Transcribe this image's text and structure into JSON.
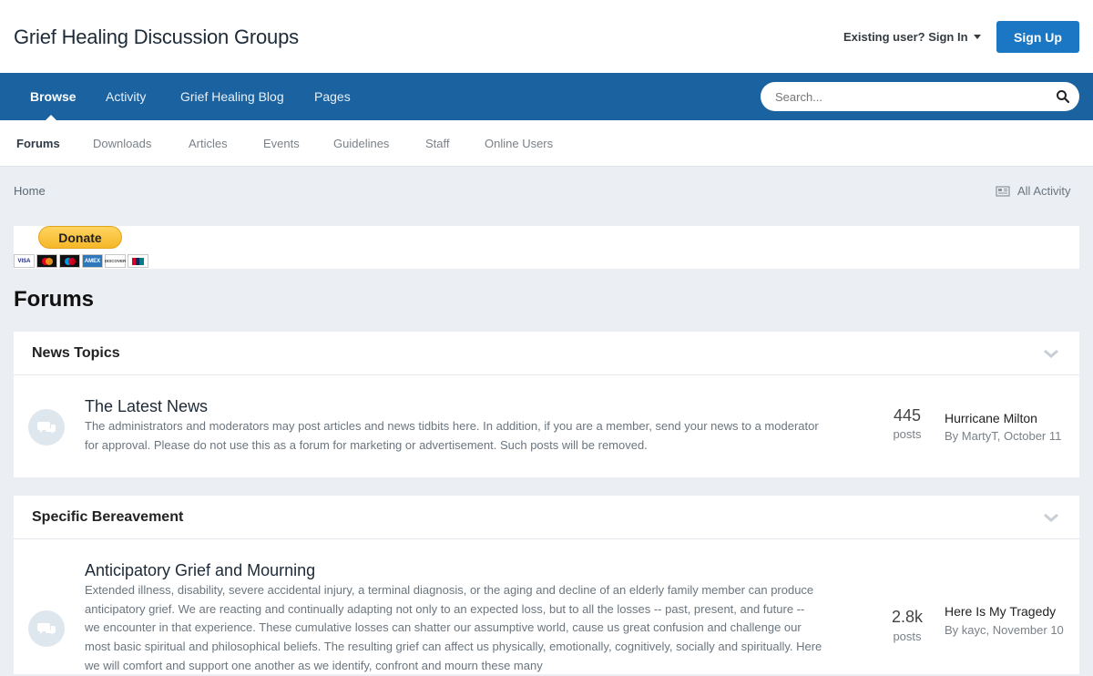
{
  "header": {
    "site_title": "Grief Healing Discussion Groups",
    "signin_label": "Existing user? Sign In",
    "signup_label": "Sign Up"
  },
  "primary_nav": {
    "items": [
      "Browse",
      "Activity",
      "Grief Healing Blog",
      "Pages"
    ],
    "active": "Browse"
  },
  "search": {
    "placeholder": "Search..."
  },
  "secondary_nav": {
    "items": [
      "Forums",
      "Downloads",
      "Articles",
      "Events",
      "Guidelines",
      "Staff",
      "Online Users"
    ],
    "active": "Forums"
  },
  "breadcrumb": {
    "home": "Home",
    "all_activity": "All Activity"
  },
  "donate": {
    "label": "Donate",
    "cards": [
      "VISA",
      "MC",
      "Maestro",
      "AMEX",
      "DISCOVER",
      "UnionPay"
    ]
  },
  "page_title": "Forums",
  "categories": [
    {
      "title": "News Topics",
      "forums": [
        {
          "name": "The Latest News",
          "description": "The administrators and moderators may post articles and news tidbits here. In addition, if you are a member, send your news to a moderator for approval. Please do not use this as a forum for marketing or advertisement. Such posts will be removed.",
          "posts_count": "445",
          "posts_label": "posts",
          "last_post_title": "Hurricane Milton",
          "last_post_by": "By MartyT, October 11"
        }
      ]
    },
    {
      "title": "Specific Bereavement",
      "forums": [
        {
          "name": "Anticipatory Grief and Mourning",
          "description": "Extended illness, disability, severe accidental injury, a terminal diagnosis, or the aging and decline of an elderly family member can produce anticipatory grief. We are reacting and continually adapting not only to an expected loss, but to all the losses -- past, present, and future -- we encounter in that experience. These cumulative losses can shatter our assumptive world, cause us great confusion and challenge our most basic spiritual and philosophical beliefs. The resulting grief can affect us physically, emotionally, cognitively, socially and spiritually. Here we will comfort and support one another as we identify, confront and mourn these many",
          "posts_count": "2.8k",
          "posts_label": "posts",
          "last_post_title": "Here Is My Tragedy",
          "last_post_by": "By kayc, November 10"
        }
      ]
    }
  ]
}
